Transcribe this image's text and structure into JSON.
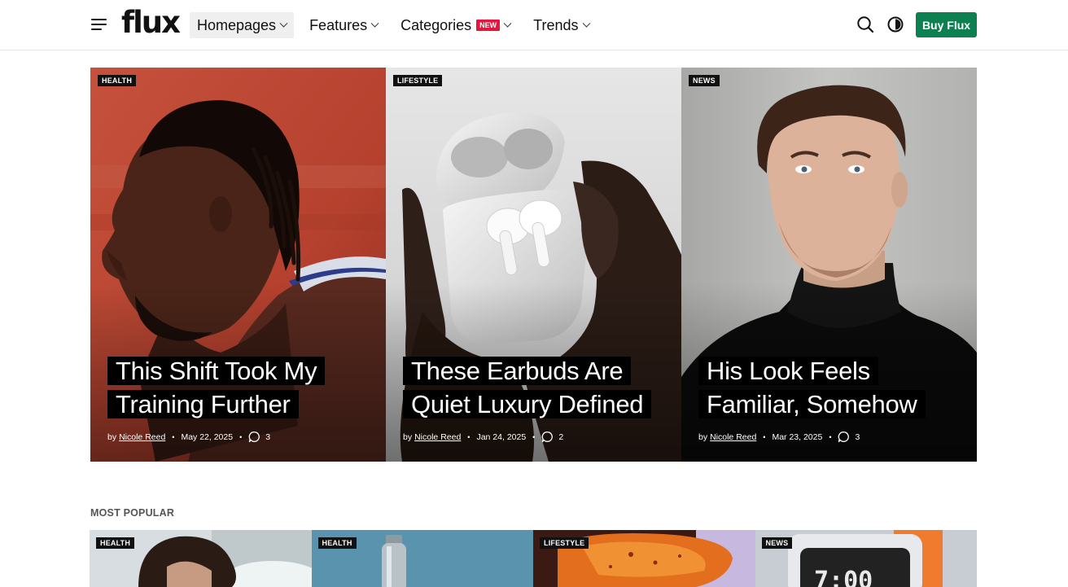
{
  "header": {
    "logo": "flux",
    "nav": [
      {
        "label": "Homepages"
      },
      {
        "label": "Features"
      },
      {
        "label": "Categories",
        "badge": "NEW"
      },
      {
        "label": "Trends"
      }
    ],
    "buy_label": "Buy Flux",
    "colors": {
      "buy": "#0d8052",
      "badge": "#e3173d"
    }
  },
  "hero": [
    {
      "category": "HEALTH",
      "title": "This Shift Took My Training Further",
      "by": "by",
      "author": "Nicole Reed",
      "date": "May 22, 2025",
      "comments": "3"
    },
    {
      "category": "LIFESTYLE",
      "title": "These Earbuds Are Quiet Luxury Defined",
      "by": "by",
      "author": "Nicole Reed",
      "date": "Jan 24, 2025",
      "comments": "2"
    },
    {
      "category": "NEWS",
      "title": "His Look Feels Familiar, Somehow",
      "by": "by",
      "author": "Nicole Reed",
      "date": "Mar 23, 2025",
      "comments": "3"
    }
  ],
  "popular": {
    "title": "MOST POPULAR",
    "items": [
      {
        "category": "HEALTH"
      },
      {
        "category": "HEALTH"
      },
      {
        "category": "LIFESTYLE"
      },
      {
        "category": "NEWS"
      }
    ]
  }
}
